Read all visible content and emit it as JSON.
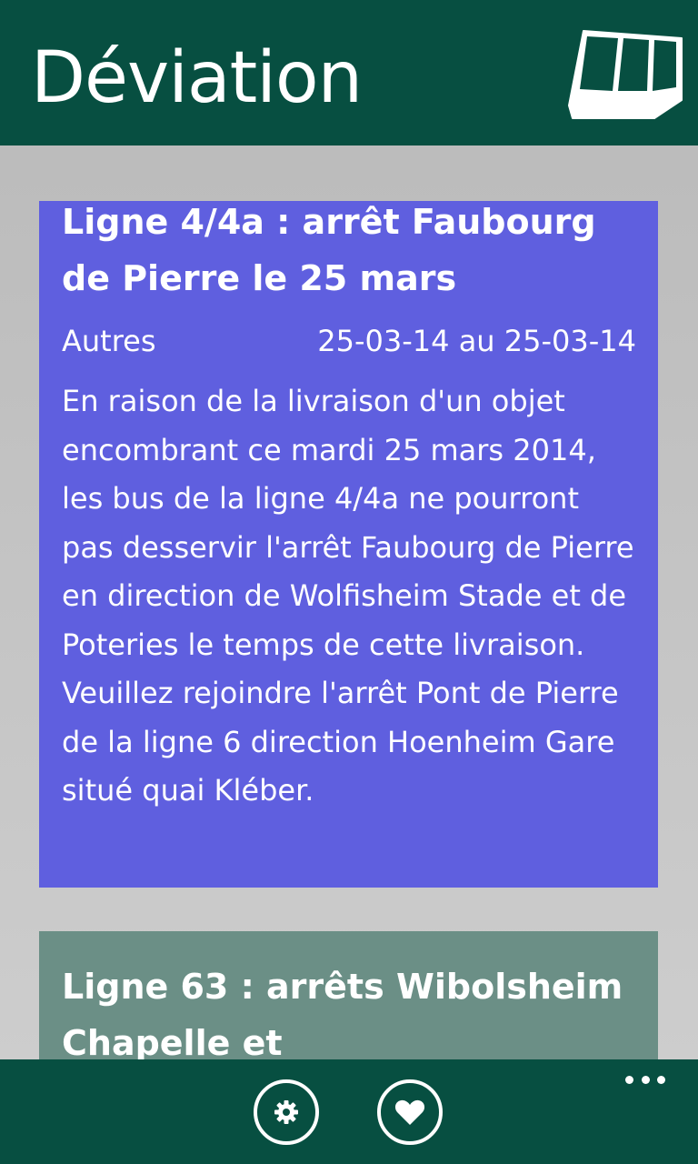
{
  "header": {
    "title": "Déviation",
    "icon": "tram-icon"
  },
  "cards": [
    {
      "title": "Ligne 4/4a : arrêt Faubourg de Pierre le 25 mars",
      "category": "Autres",
      "dates": "25-03-14 au 25-03-14",
      "body": "En raison de la livraison d'un objet encombrant ce mardi 25 mars 2014, les bus de la ligne 4/4a ne pourront pas desservir l'arrêt Faubourg de Pierre en direction de Wolfisheim Stade et de Poteries le temps de cette livraison.\nVeuillez rejoindre l'arrêt Pont de Pierre de la ligne 6 direction Hoenheim Gare situé quai Kléber.",
      "color": "#5f5fdf"
    },
    {
      "title": "Ligne 63 : arrêts Wibolsheim Chapelle et",
      "color": "#6b8f86"
    }
  ],
  "appbar": {
    "buttons": [
      {
        "icon": "gear-icon"
      },
      {
        "icon": "heart-icon"
      }
    ],
    "more_icon": "more-dots-icon"
  },
  "colors": {
    "header_bg": "#074f41",
    "appbar_bg": "#074f41"
  }
}
